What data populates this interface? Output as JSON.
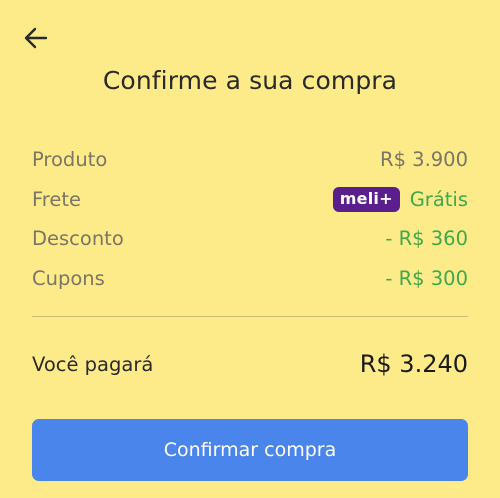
{
  "header": {
    "back_icon": "arrow-left-icon",
    "title": "Confirme a sua compra"
  },
  "summary": {
    "product": {
      "label": "Produto",
      "value": "R$ 3.900"
    },
    "freight": {
      "label": "Frete",
      "badge": "meli+",
      "value": "Grátis"
    },
    "discount": {
      "label": "Desconto",
      "value": "- R$ 360"
    },
    "coupons": {
      "label": "Cupons",
      "value": "- R$ 300"
    }
  },
  "total": {
    "label": "Você pagará",
    "value": "R$ 3.240"
  },
  "actions": {
    "confirm_label": "Confirmar compra"
  },
  "colors": {
    "background": "#fdeb8a",
    "accent_button": "#4a85ec",
    "positive_green": "#3ea84b",
    "meli_badge": "#5a1e8f"
  }
}
